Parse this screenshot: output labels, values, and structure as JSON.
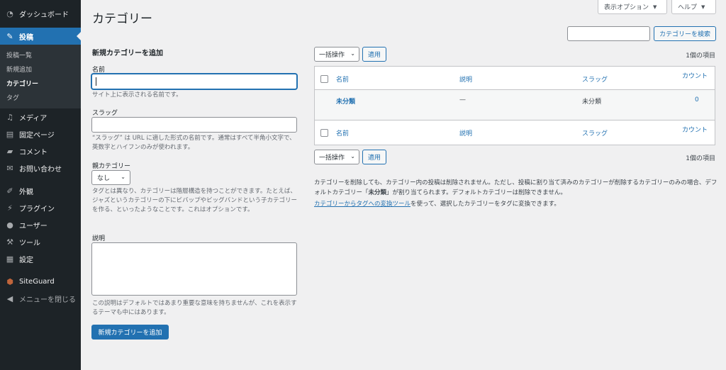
{
  "sidebar": {
    "dashboard": "ダッシュボード",
    "posts": "投稿",
    "submenu": [
      "投稿一覧",
      "新規追加",
      "カテゴリー",
      "タグ"
    ],
    "media": "メディア",
    "pages": "固定ページ",
    "comments": "コメント",
    "contact": "お問い合わせ",
    "appearance": "外観",
    "plugins": "プラグイン",
    "users": "ユーザー",
    "tools": "ツール",
    "settings": "設定",
    "siteguard": "SiteGuard",
    "collapse": "メニューを閉じる"
  },
  "header": {
    "title": "カテゴリー",
    "screen_options": "表示オプション",
    "help": "ヘルプ"
  },
  "search": {
    "button": "カテゴリーを検索",
    "value": ""
  },
  "form": {
    "heading": "新規カテゴリーを追加",
    "name_label": "名前",
    "name_help": "サイト上に表示される名前です。",
    "slug_label": "スラッグ",
    "slug_help": "“スラッグ” は URL に適した形式の名前です。通常はすべて半角小文字で、英数字とハイフンのみが使われます。",
    "parent_label": "親カテゴリー",
    "parent_value": "なし",
    "parent_help": "タグとは異なり、カテゴリーは階層構造を持つことができます。たとえば、ジャズというカテゴリーの下にビバップやビッグバンドという子カテゴリーを作る、といったようなことです。これはオプションです。",
    "desc_label": "説明",
    "desc_help": "この説明はデフォルトではあまり重要な意味を持ちませんが、これを表示するテーマも中にはあります。",
    "submit": "新規カテゴリーを追加"
  },
  "list": {
    "bulk_action": "一括操作",
    "apply": "適用",
    "item_count": "1個の項目",
    "columns": {
      "name": "名前",
      "description": "説明",
      "slug": "スラッグ",
      "count": "カウント"
    },
    "rows": [
      {
        "name": "未分類",
        "description": "—",
        "slug": "未分類",
        "count": "0"
      }
    ]
  },
  "notes": {
    "line1": "カテゴリーを削除しても、カテゴリー内の投稿は削除されません。ただし、投稿に割り当て済みのカテゴリーが削除するカテゴリーのみの場合、デフォルトカテゴリー「",
    "default_cat": "未分類",
    "line1_end": "」が割り当てられます。デフォルトカテゴリーは削除できません。",
    "link": "カテゴリーからタグへの変換ツール",
    "line2": "を使って、選択したカテゴリーをタグに変換できます。"
  },
  "colors": {
    "accent": "#2271b1",
    "sidebar_bg": "#1d2327",
    "page_bg": "#f0f0f1"
  }
}
